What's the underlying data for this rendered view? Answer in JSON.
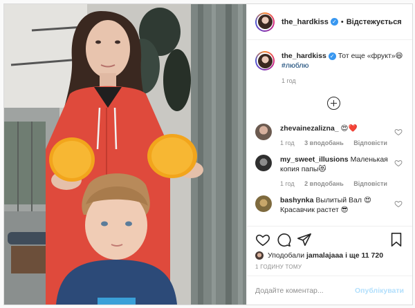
{
  "post": {
    "username": "the_hardkiss",
    "follow_status": "Відстежується",
    "caption_text": "Тот еще «фрукт»😄",
    "caption_hashtag": "#люблю",
    "caption_time": "1 год"
  },
  "comments": [
    {
      "username": "zhevainezalizna_",
      "text": "😍❤️",
      "time": "1 год",
      "likes": "3 вподобань",
      "reply": "Відповісти",
      "avatar_color": "#6b5a50"
    },
    {
      "username": "my_sweet_illusions",
      "text": "Маленькая копия папы😻",
      "time": "1 год",
      "likes": "2 вподобань",
      "reply": "Відповісти",
      "avatar_color": "#2f2f2f"
    },
    {
      "username": "bashynka",
      "text": "Вылитый Вал 😍 Красавчик растет 😎",
      "avatar_color": "#7e6a3e"
    }
  ],
  "likes": {
    "prefix": "Уподобали",
    "user": "jamalajaaa",
    "suffix": "і ще 11 720"
  },
  "timestamp": "1 годину тому",
  "add_comment": {
    "placeholder": "Додайте коментар...",
    "publish_label": "Опублікувати"
  },
  "icons": {
    "verified": "verified-badge-icon",
    "like": "heart-icon",
    "comment": "comment-bubble-icon",
    "share": "paper-plane-icon",
    "save": "bookmark-icon",
    "more_comments": "plus-circle-icon"
  },
  "colors": {
    "verified": "#3897f0",
    "muted": "#8e8e8e",
    "publish": "#b2dffc",
    "hashtag": "#00376b"
  }
}
